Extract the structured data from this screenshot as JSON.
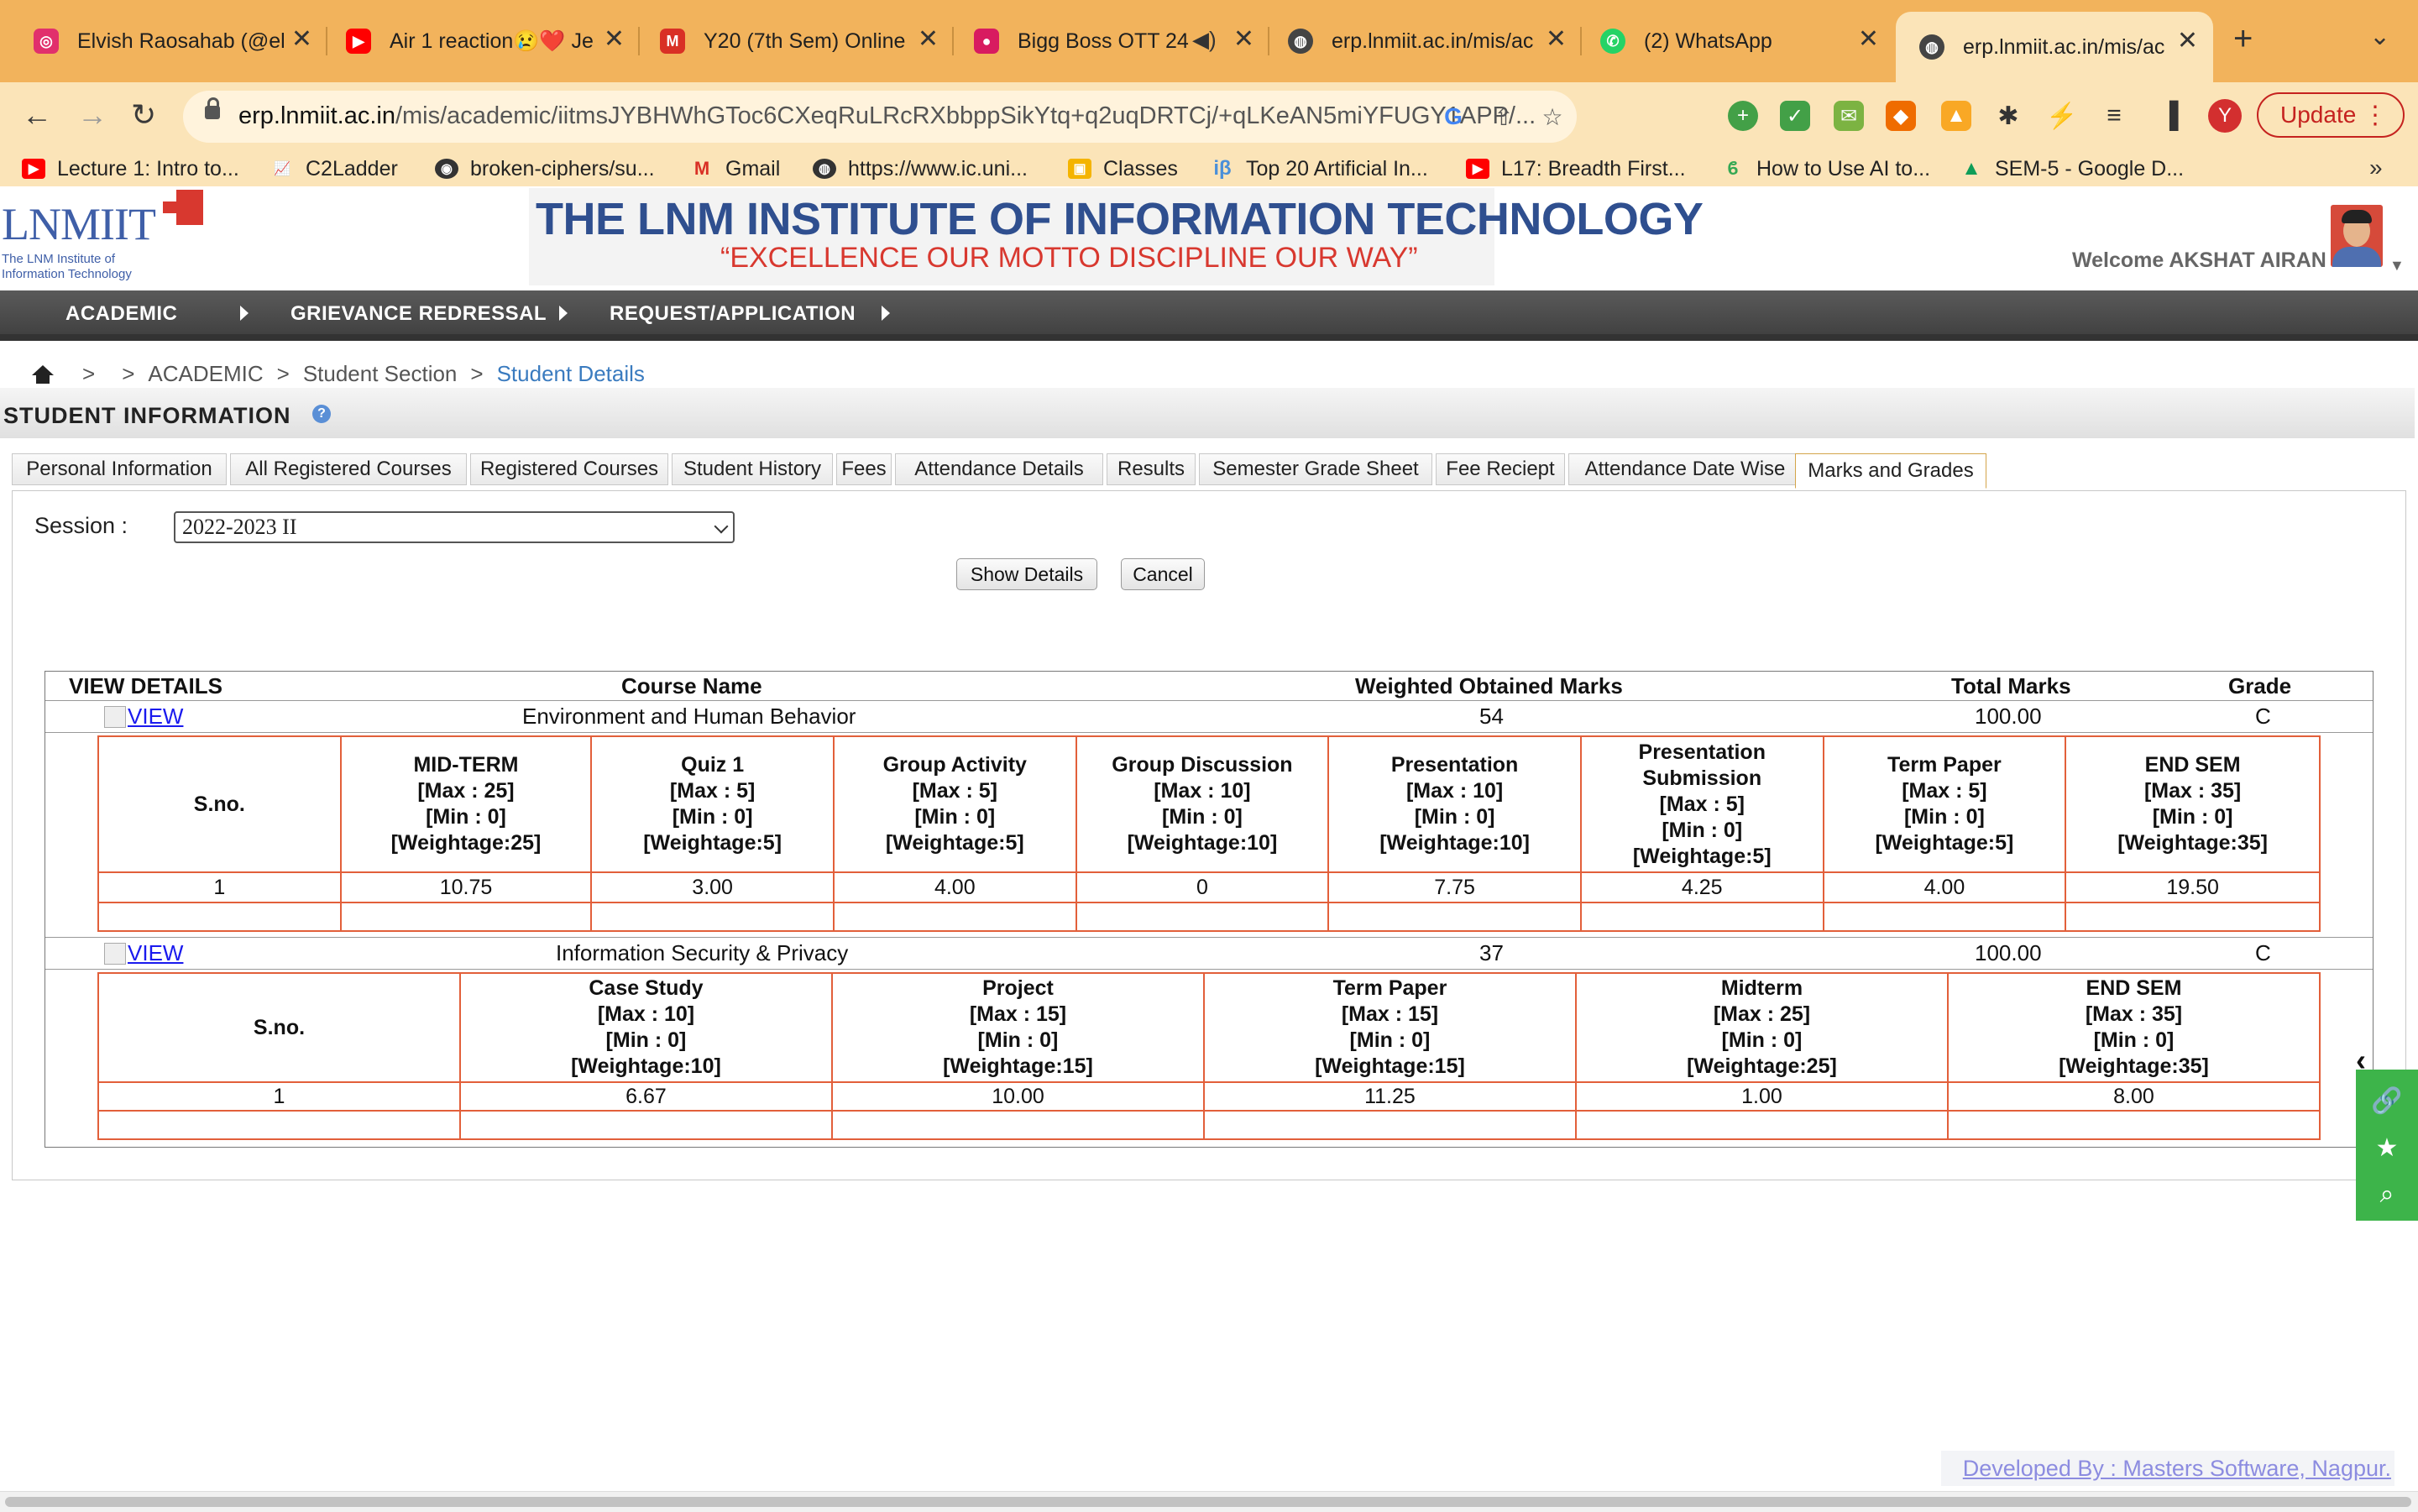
{
  "browser": {
    "tabs": [
      {
        "title": "Elvish Raosahab (@el",
        "icon": "instagram-icon",
        "color": "#e1306c"
      },
      {
        "title": "Air 1 reaction😢❤️ Je",
        "icon": "youtube-icon",
        "color": "#ff0000"
      },
      {
        "title": "Y20 (7th Sem) Online",
        "icon": "gmail-icon",
        "color": "#d93025"
      },
      {
        "title": "Bigg Boss OTT 24",
        "icon": "jiocinema-icon",
        "color": "#d81b60"
      },
      {
        "title": "erp.lnmiit.ac.in/mis/ac",
        "icon": "globe-icon",
        "color": "#444444"
      },
      {
        "title": "(2) WhatsApp",
        "icon": "whatsapp-icon",
        "color": "#25d366"
      },
      {
        "title": "erp.lnmiit.ac.in/mis/ac",
        "icon": "globe-icon",
        "color": "#444444"
      }
    ],
    "url_domain": "erp.lnmiit.ac.in",
    "url_path": "/mis/academic/iitmsJYBHWhGToc6CXeqRuLRcRXbbppSikYtq+q2uqDRTCj/+qLKeAN5miYFUGY1APP/...",
    "profile_letter": "Y",
    "update_label": "Update",
    "bookmarks": [
      {
        "label": "Lecture 1: Intro to...",
        "icon": "youtube-icon",
        "color": "#ff0000"
      },
      {
        "label": "C2Ladder",
        "icon": "chart-icon",
        "color": "#d35400"
      },
      {
        "label": "broken-ciphers/su...",
        "icon": "github-icon",
        "color": "#333333"
      },
      {
        "label": "Gmail",
        "icon": "gmail-icon",
        "color": "#d93025"
      },
      {
        "label": "https://www.ic.uni...",
        "icon": "globe-icon",
        "color": "#333333"
      },
      {
        "label": "Classes",
        "icon": "classroom-icon",
        "color": "#f4b400"
      },
      {
        "label": "Top 20 Artificial In...",
        "icon": "beta-icon",
        "color": "#4a90d9"
      },
      {
        "label": "L17: Breadth First...",
        "icon": "youtube-icon",
        "color": "#ff0000"
      },
      {
        "label": "How to Use AI to...",
        "icon": "leaf-icon",
        "color": "#34a853"
      },
      {
        "label": "SEM-5 - Google D...",
        "icon": "google-drive-icon",
        "color": "#0f9d58"
      }
    ]
  },
  "header": {
    "logo_text": "LNMIIT",
    "logo_subtitle": "The LNM Institute of Information Technology",
    "institute_name": "THE LNM INSTITUTE OF INFORMATION TECHNOLOGY",
    "motto": "“EXCELLENCE OUR MOTTO DISCIPLINE OUR WAY”",
    "welcome": "Welcome AKSHAT AIRAN"
  },
  "menu": [
    "ACADEMIC",
    "GRIEVANCE REDRESSAL",
    "REQUEST/APPLICATION"
  ],
  "breadcrumb": {
    "sep": ">",
    "items": [
      "ACADEMIC",
      "Student Section",
      "Student Details"
    ]
  },
  "section_title": "STUDENT INFORMATION",
  "tabs": [
    "Personal Information",
    "All Registered Courses",
    "Registered Courses",
    "Student History",
    "Fees",
    "Attendance Details",
    "Results",
    "Semester Grade Sheet",
    "Fee Reciept",
    "Attendance Date Wise",
    "Marks and Grades"
  ],
  "active_tab": "Marks and Grades",
  "form": {
    "session_label": "Session :",
    "session_value": "2022-2023 II",
    "show_details": "Show Details",
    "cancel": "Cancel"
  },
  "results": {
    "headers": {
      "view": "VIEW DETAILS",
      "course": "Course Name",
      "weighted": "Weighted Obtained Marks",
      "total": "Total Marks",
      "grade": "Grade"
    },
    "view_label": "VIEW",
    "sno_header": "S.no.",
    "courses": [
      {
        "name": "Environment and Human Behavior",
        "weighted": "54",
        "total": "100.00",
        "grade": "C",
        "components": [
          [
            "MID-TERM",
            "[Max : 25]",
            "[Min : 0]",
            "[Weightage:25]"
          ],
          [
            "Quiz 1",
            "[Max : 5]",
            "[Min : 0]",
            "[Weightage:5]"
          ],
          [
            "Group Activity",
            "[Max : 5]",
            "[Min : 0]",
            "[Weightage:5]"
          ],
          [
            "Group Discussion",
            "[Max : 10]",
            "[Min : 0]",
            "[Weightage:10]"
          ],
          [
            "Presentation",
            "[Max : 10]",
            "[Min : 0]",
            "[Weightage:10]"
          ],
          [
            "Presentation Submission",
            "[Max : 5]",
            "[Min : 0]",
            "[Weightage:5]"
          ],
          [
            "Term Paper",
            "[Max : 5]",
            "[Min : 0]",
            "[Weightage:5]"
          ],
          [
            "END SEM",
            "[Max : 35]",
            "[Min : 0]",
            "[Weightage:35]"
          ]
        ],
        "row": [
          "1",
          "10.75",
          "3.00",
          "4.00",
          "0",
          "7.75",
          "4.25",
          "4.00",
          "19.50"
        ]
      },
      {
        "name": "Information Security & Privacy",
        "weighted": "37",
        "total": "100.00",
        "grade": "C",
        "components": [
          [
            "Case Study",
            "[Max : 10]",
            "[Min : 0]",
            "[Weightage:10]"
          ],
          [
            "Project",
            "[Max : 15]",
            "[Min : 0]",
            "[Weightage:15]"
          ],
          [
            "Term Paper",
            "[Max : 15]",
            "[Min : 0]",
            "[Weightage:15]"
          ],
          [
            "Midterm",
            "[Max : 25]",
            "[Min : 0]",
            "[Weightage:25]"
          ],
          [
            "END SEM",
            "[Max : 35]",
            "[Min : 0]",
            "[Weightage:35]"
          ]
        ],
        "row": [
          "1",
          "6.67",
          "10.00",
          "11.25",
          "1.00",
          "8.00"
        ]
      }
    ]
  },
  "footer": "Developed By : Masters Software, Nagpur."
}
